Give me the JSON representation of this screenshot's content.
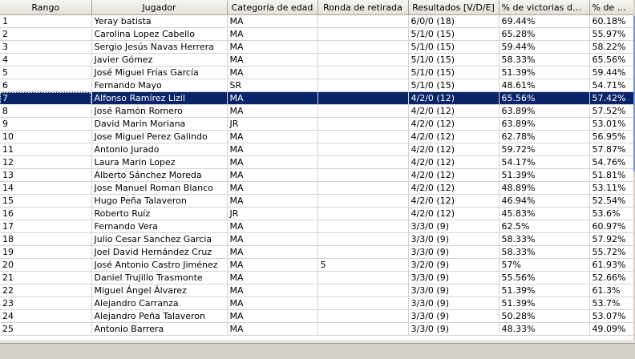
{
  "columns": [
    "Rango",
    "Jugador",
    "Categoría de edad",
    "Ronda de retirada",
    "Resultados [V/D/E]",
    "% de victorias de los...",
    "% de vic..."
  ],
  "selected_row": 6,
  "rows": [
    [
      "1",
      "Yeray batista",
      "MA",
      "",
      "6/0/0 (18)",
      "69.44%",
      "60.18%"
    ],
    [
      "2",
      "Carolina Lopez Cabello",
      "MA",
      "",
      "5/1/0 (15)",
      "65.28%",
      "55.97%"
    ],
    [
      "3",
      "Sergio Jesús Navas Herrera",
      "MA",
      "",
      "5/1/0 (15)",
      "59.44%",
      "58.22%"
    ],
    [
      "4",
      "Javier Gómez",
      "MA",
      "",
      "5/1/0 (15)",
      "58.33%",
      "65.56%"
    ],
    [
      "5",
      "José Miguel Frías García",
      "MA",
      "",
      "5/1/0 (15)",
      "51.39%",
      "59.44%"
    ],
    [
      "6",
      "Fernando Mayo",
      "SR",
      "",
      "5/1/0 (15)",
      "48.61%",
      "54.71%"
    ],
    [
      "7",
      "Alfonso Ramírez Lizil",
      "MA",
      "",
      "4/2/0 (12)",
      "65.56%",
      "57.42%"
    ],
    [
      "8",
      "José Ramón Romero",
      "MA",
      "",
      "4/2/0 (12)",
      "63.89%",
      "57.52%"
    ],
    [
      "9",
      "David Marin Moriana",
      "JR",
      "",
      "4/2/0 (12)",
      "63.89%",
      "53.01%"
    ],
    [
      "10",
      "Jose Miguel Perez Galindo",
      "MA",
      "",
      "4/2/0 (12)",
      "62.78%",
      "56.95%"
    ],
    [
      "11",
      "Antonio Jurado",
      "MA",
      "",
      "4/2/0 (12)",
      "59.72%",
      "57.87%"
    ],
    [
      "12",
      "Laura Marin Lopez",
      "MA",
      "",
      "4/2/0 (12)",
      "54.17%",
      "54.76%"
    ],
    [
      "13",
      "Alberto Sánchez Moreda",
      "MA",
      "",
      "4/2/0 (12)",
      "51.39%",
      "51.81%"
    ],
    [
      "14",
      "Jose Manuel Roman Blanco",
      "MA",
      "",
      "4/2/0 (12)",
      "48.89%",
      "53.11%"
    ],
    [
      "15",
      "Hugo Peña Talaveron",
      "MA",
      "",
      "4/2/0 (12)",
      "46.94%",
      "52.54%"
    ],
    [
      "16",
      "Roberto Ruíz",
      "JR",
      "",
      "4/2/0 (12)",
      "45.83%",
      "53.6%"
    ],
    [
      "17",
      "Fernando Vera",
      "MA",
      "",
      "3/3/0 (9)",
      "62.5%",
      "60.97%"
    ],
    [
      "18",
      "Julio Cesar Sanchez Garcia",
      "MA",
      "",
      "3/3/0 (9)",
      "58.33%",
      "57.92%"
    ],
    [
      "19",
      "Joel David Hernández Cruz",
      "MA",
      "",
      "3/3/0 (9)",
      "58.33%",
      "55.72%"
    ],
    [
      "20",
      "José Antonio Castro Jiménez",
      "MA",
      "5",
      "3/2/0 (9)",
      "57%",
      "61.93%"
    ],
    [
      "21",
      "Daniel Trujillo Trasmonte",
      "MA",
      "",
      "3/3/0 (9)",
      "55.56%",
      "52.66%"
    ],
    [
      "22",
      "Miguel Ángel Álvarez",
      "MA",
      "",
      "3/3/0 (9)",
      "51.39%",
      "61.3%"
    ],
    [
      "23",
      "Alejandro Carranza",
      "MA",
      "",
      "3/3/0 (9)",
      "51.39%",
      "53.7%"
    ],
    [
      "24",
      "Alejandro Peña Talaveron",
      "MA",
      "",
      "3/3/0 (9)",
      "50.28%",
      "53.07%"
    ],
    [
      "25",
      "Antonio Barrera",
      "MA",
      "",
      "3/3/0 (9)",
      "48.33%",
      "49.09%"
    ]
  ]
}
